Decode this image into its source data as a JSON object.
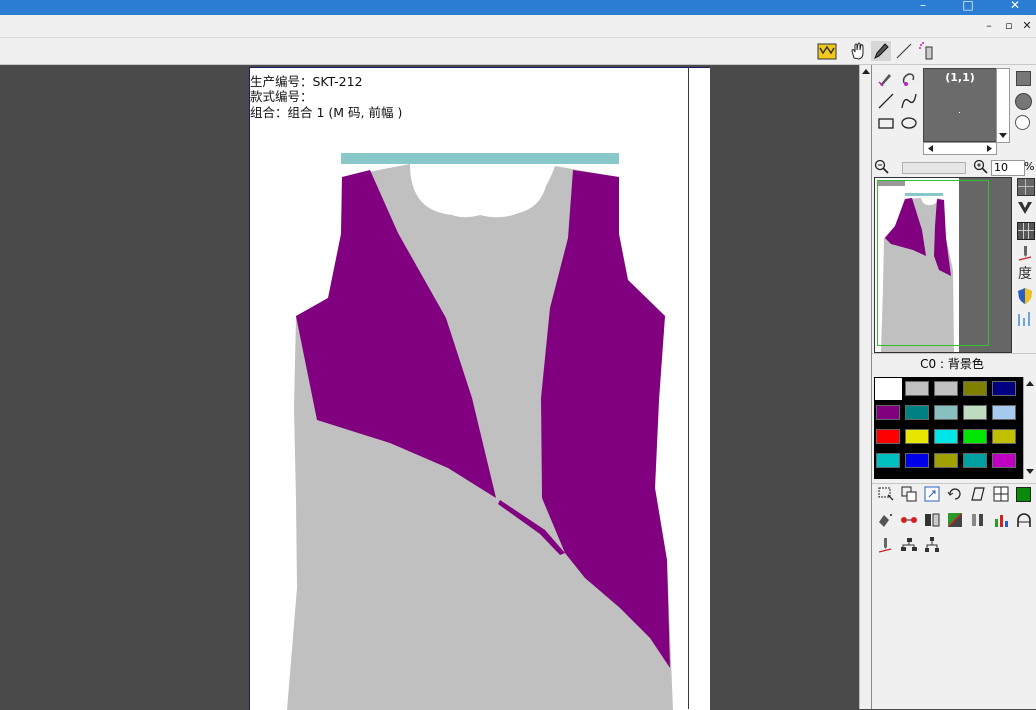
{
  "window": {
    "minimize_glyph": "–",
    "maximize_glyph": "□",
    "close_glyph": "✕"
  },
  "mdi": {
    "minimize_glyph": "–",
    "restore_glyph": "▫",
    "close_glyph": "✕"
  },
  "sheet": {
    "info": {
      "line1": "生产编号：SKT-212",
      "line2": "款式编号：",
      "line3": "组合：组合 1 (M 码, 前幅 )"
    }
  },
  "panel": {
    "preview_coord": "(1,1)",
    "zoom_value": "10",
    "zoom_unit": "%",
    "degree_glyph": "度",
    "layer_label": "C0 : 背景色",
    "palette": [
      "#ffffff",
      "#c0c0c0",
      "#c0c0c0",
      "#808000",
      "#000080",
      "#800080",
      "#008080",
      "#88c0c0",
      "#c0dcc0",
      "#a6caf0",
      "#ff0000",
      "#e6e600",
      "#00e6e6",
      "#00e600",
      "#c0c000",
      "#00c0c0",
      "#0000e6",
      "#a0a000",
      "#00a0a0",
      "#c000c0"
    ]
  },
  "colors": {
    "accent": "#2b7cd3",
    "garment_purple": "#800080",
    "garment_gray": "#c0c0c0",
    "neck_band": "#88c8c8"
  }
}
